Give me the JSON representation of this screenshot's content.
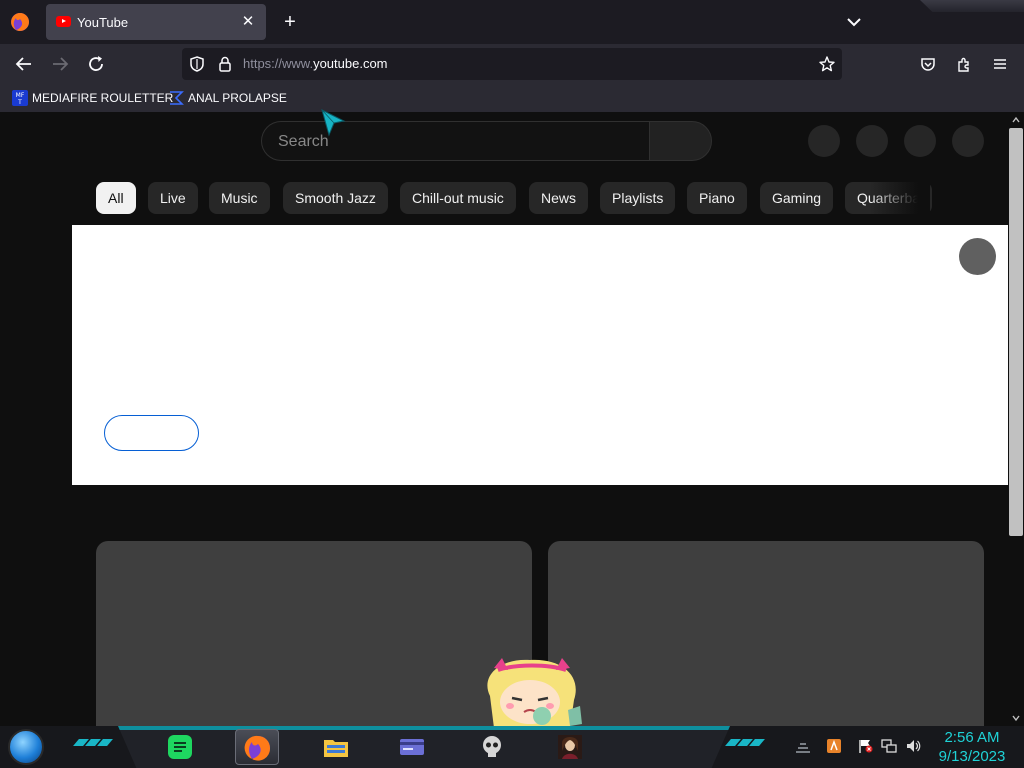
{
  "browser": {
    "tab": {
      "title": "YouTube",
      "favicon": "youtube-icon"
    },
    "url": {
      "prefix": "https://www.",
      "domain": "youtube.com"
    },
    "bookmarks": [
      {
        "label": "MEDIAFIRE ROULETTER",
        "icon": "mediafire-icon"
      },
      {
        "label": "ANAL PROLAPSE",
        "icon": "sigma-icon"
      }
    ],
    "colors": {
      "tabbar": "#1c1b22",
      "toolbar": "#2b2a33",
      "active_tab": "#42414d"
    }
  },
  "youtube": {
    "search": {
      "placeholder": "Search"
    },
    "chips": [
      {
        "label": "All",
        "active": true
      },
      {
        "label": "Live",
        "active": false
      },
      {
        "label": "Music",
        "active": false
      },
      {
        "label": "Smooth Jazz",
        "active": false
      },
      {
        "label": "Chill-out music",
        "active": false
      },
      {
        "label": "News",
        "active": false
      },
      {
        "label": "Playlists",
        "active": false
      },
      {
        "label": "Piano",
        "active": false
      },
      {
        "label": "Gaming",
        "active": false
      },
      {
        "label": "Quarterba",
        "active": false
      }
    ],
    "colors": {
      "background": "#0f0f0f",
      "chip": "#272727",
      "chip_active": "#f1f1f1",
      "placeholder": "#3f3f3f",
      "accent_blue": "#065fd4"
    }
  },
  "taskbar": {
    "apps": [
      {
        "name": "notes-app",
        "icon": "notes-icon",
        "active": false
      },
      {
        "name": "firefox",
        "icon": "firefox-icon",
        "active": true
      },
      {
        "name": "file-explorer",
        "icon": "folder-icon",
        "active": false
      },
      {
        "name": "id-card-app",
        "icon": "card-icon",
        "active": false
      },
      {
        "name": "skull-app",
        "icon": "skull-icon",
        "active": false
      },
      {
        "name": "portrait-app",
        "icon": "portrait-icon",
        "active": false
      }
    ],
    "tray": [
      "network-icon",
      "flag-icon",
      "monitor-icon",
      "volume-icon"
    ],
    "clock": {
      "time": "2:56 AM",
      "date": "9/13/2023"
    },
    "colors": {
      "accent": "#19b6c6",
      "clock": "#1fd2d6"
    }
  }
}
